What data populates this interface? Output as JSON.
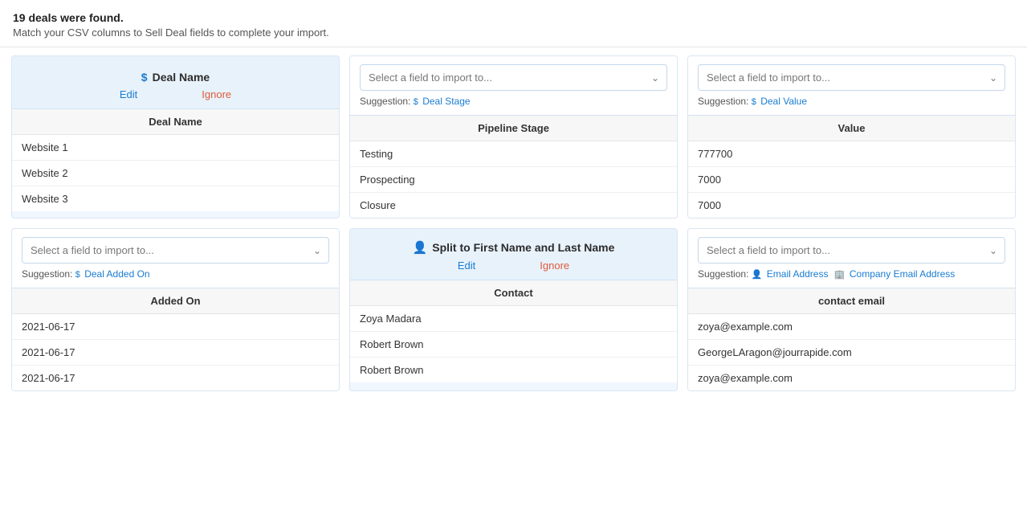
{
  "header": {
    "title": "19 deals were found.",
    "subtitle": "Match your CSV columns to Sell Deal fields to complete your import."
  },
  "cards": [
    {
      "id": "deal-name",
      "type": "column-with-actions",
      "header_icon": "dollar",
      "header_title": "Deal Name",
      "edit_label": "Edit",
      "ignore_label": "Ignore",
      "column_header": "Deal Name",
      "rows": [
        "Website 1",
        "Website 2",
        "Website 3"
      ]
    },
    {
      "id": "pipeline-stage",
      "type": "dropdown-only",
      "select_placeholder": "Select a field to import to...",
      "suggestion_prefix": "Suggestion:",
      "suggestion_icon": "dollar",
      "suggestion_label": "Deal Stage",
      "column_header": "Pipeline Stage",
      "rows": [
        "Testing",
        "Prospecting",
        "Closure"
      ]
    },
    {
      "id": "value",
      "type": "dropdown-only",
      "select_placeholder": "Select a field to import to...",
      "suggestion_prefix": "Suggestion:",
      "suggestion_icon": "dollar",
      "suggestion_label": "Deal Value",
      "column_header": "Value",
      "rows": [
        "777700",
        "7000",
        "7000"
      ]
    },
    {
      "id": "added-on",
      "type": "dropdown-only",
      "select_placeholder": "Select a field to import to...",
      "suggestion_prefix": "Suggestion:",
      "suggestion_icon": "dollar",
      "suggestion_label": "Deal Added On",
      "column_header": "Added On",
      "rows": [
        "2021-06-17",
        "2021-06-17",
        "2021-06-17"
      ]
    },
    {
      "id": "contact",
      "type": "split-header",
      "header_icon": "person",
      "header_title": "Split to First Name and Last Name",
      "edit_label": "Edit",
      "ignore_label": "Ignore",
      "column_header": "Contact",
      "rows": [
        "Zoya Madara",
        "Robert Brown",
        "Robert Brown"
      ]
    },
    {
      "id": "contact-email",
      "type": "dropdown-multi-suggestion",
      "select_placeholder": "Select a field to import to...",
      "suggestion_prefix": "Suggestion:",
      "suggestion1_icon": "person",
      "suggestion1_label": "Email Address",
      "suggestion2_icon": "building",
      "suggestion2_label": "Company Email Address",
      "column_header": "contact email",
      "rows": [
        "zoya@example.com",
        "GeorgeLAragon@jourrapide.com",
        "zoya@example.com"
      ]
    }
  ]
}
